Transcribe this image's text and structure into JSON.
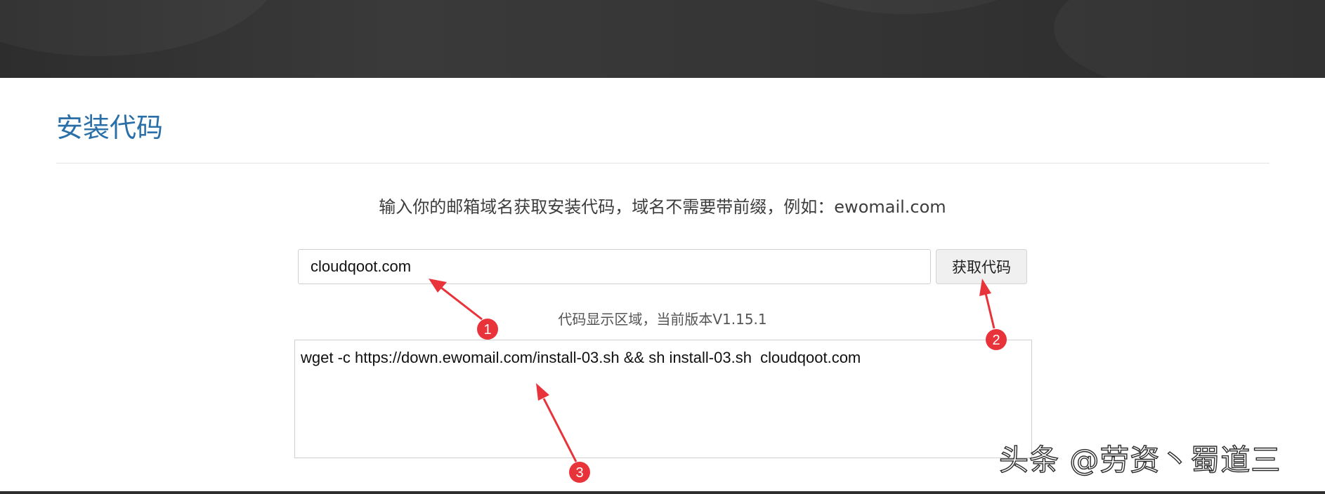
{
  "page": {
    "title": "安装代码",
    "instruction": "输入你的邮箱域名获取安装代码，域名不需要带前缀，例如：ewomail.com"
  },
  "form": {
    "domain_value": "cloudqoot.com",
    "get_code_label": "获取代码"
  },
  "output": {
    "label": "代码显示区域，当前版本V1.15.1",
    "code": "wget -c https://down.ewomail.com/install-03.sh && sh install-03.sh  cloudqoot.com"
  },
  "annotations": {
    "markers": [
      "1",
      "2",
      "3"
    ]
  },
  "watermark": "头条 @劳资丶蜀道三",
  "colors": {
    "title": "#2a6fa8",
    "marker": "#e8333a",
    "banner": "#333333"
  }
}
